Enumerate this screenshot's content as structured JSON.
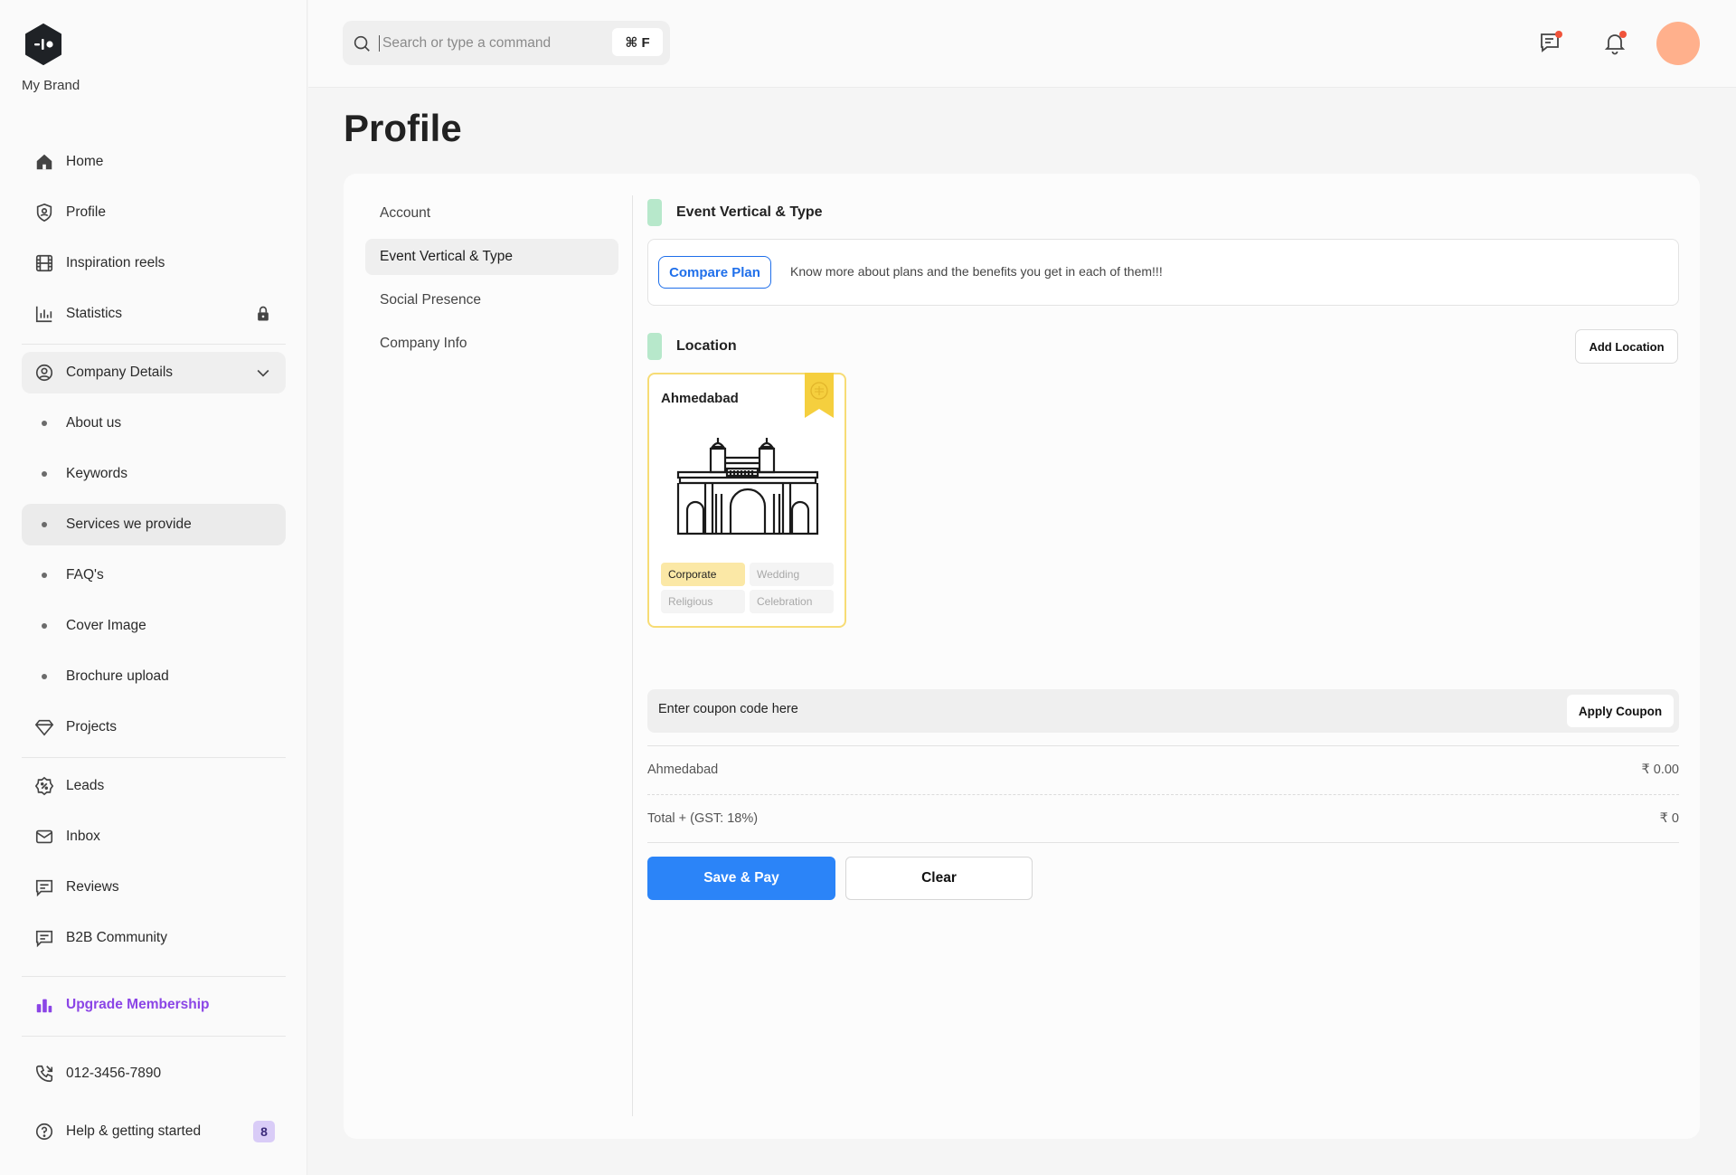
{
  "brand": {
    "name": "My Brand",
    "logo_icon": "brand-logo-icon"
  },
  "sidebar": {
    "items": [
      {
        "label": "Home",
        "icon": "home-icon"
      },
      {
        "label": "Profile",
        "icon": "profile-shield-icon"
      },
      {
        "label": "Inspiration reels",
        "icon": "film-icon"
      },
      {
        "label": "Statistics",
        "icon": "bar-chart-icon",
        "locked": true
      },
      {
        "label": "Company Details",
        "icon": "user-circle-icon",
        "expanded": true
      },
      {
        "label": "About us"
      },
      {
        "label": "Keywords"
      },
      {
        "label": "Services we provide",
        "active": true
      },
      {
        "label": "FAQ's"
      },
      {
        "label": "Cover Image"
      },
      {
        "label": "Brochure upload"
      },
      {
        "label": "Projects",
        "icon": "diamond-icon"
      },
      {
        "label": "Leads",
        "icon": "percent-badge-icon"
      },
      {
        "label": "Inbox",
        "icon": "mail-icon"
      },
      {
        "label": "Reviews",
        "icon": "message-square-icon"
      },
      {
        "label": "B2B Community",
        "icon": "message-square-icon"
      },
      {
        "label": "Upgrade Membership",
        "icon": "upgrade-chart-icon",
        "color": "#8b45e6"
      },
      {
        "label": "012-3456-7890",
        "icon": "phone-icon"
      },
      {
        "label": "Help & getting started",
        "icon": "help-circle-icon",
        "badge": "8"
      }
    ]
  },
  "topbar": {
    "search_placeholder": "Search or type a command",
    "search_shortcut": "⌘ F",
    "icons": [
      "chat-notification-icon",
      "bell-icon"
    ],
    "avatar_color": "#ffb08c"
  },
  "page": {
    "title": "Profile"
  },
  "subnav": {
    "items": [
      {
        "label": "Account"
      },
      {
        "label": "Event Vertical & Type",
        "active": true
      },
      {
        "label": "Social Presence"
      },
      {
        "label": "Company Info"
      }
    ]
  },
  "event_section": {
    "title": "Event Vertical & Type",
    "compare_button": "Compare Plan",
    "compare_text": "Know more about plans and the benefits you get in each of them!!!"
  },
  "location_section": {
    "title": "Location",
    "add_button": "Add Location",
    "card": {
      "city": "Ahmedabad",
      "tags": [
        {
          "label": "Corporate",
          "selected": true
        },
        {
          "label": "Wedding",
          "selected": false
        },
        {
          "label": "Religious",
          "selected": false
        },
        {
          "label": "Celebration",
          "selected": false
        }
      ]
    }
  },
  "coupon": {
    "placeholder": "Enter coupon code here",
    "apply_button": "Apply Coupon"
  },
  "summary": {
    "rows": [
      {
        "label": "Ahmedabad",
        "value": "₹ 0.00"
      },
      {
        "label": "Total + (GST: 18%)",
        "value": "₹ 0"
      }
    ]
  },
  "actions": {
    "save": "Save & Pay",
    "clear": "Clear"
  },
  "colors": {
    "primary": "#2b84f8",
    "accent_purple": "#8b45e6",
    "section_marker": "#b7e8cb",
    "card_border": "#f7dc75"
  }
}
